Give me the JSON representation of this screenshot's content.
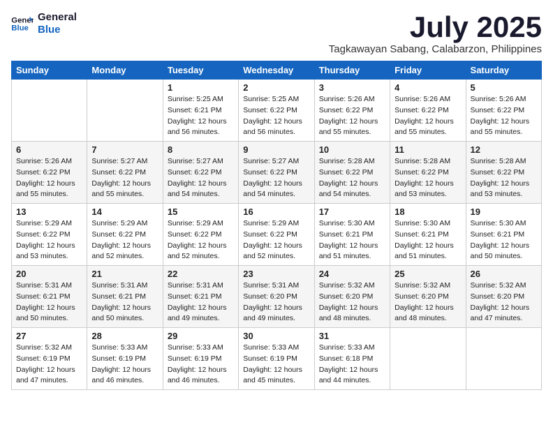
{
  "logo": {
    "line1": "General",
    "line2": "Blue"
  },
  "title": "July 2025",
  "subtitle": "Tagkawayan Sabang, Calabarzon, Philippines",
  "headers": [
    "Sunday",
    "Monday",
    "Tuesday",
    "Wednesday",
    "Thursday",
    "Friday",
    "Saturday"
  ],
  "weeks": [
    [
      {
        "day": "",
        "details": ""
      },
      {
        "day": "",
        "details": ""
      },
      {
        "day": "1",
        "details": "Sunrise: 5:25 AM\nSunset: 6:21 PM\nDaylight: 12 hours\nand 56 minutes."
      },
      {
        "day": "2",
        "details": "Sunrise: 5:25 AM\nSunset: 6:22 PM\nDaylight: 12 hours\nand 56 minutes."
      },
      {
        "day": "3",
        "details": "Sunrise: 5:26 AM\nSunset: 6:22 PM\nDaylight: 12 hours\nand 55 minutes."
      },
      {
        "day": "4",
        "details": "Sunrise: 5:26 AM\nSunset: 6:22 PM\nDaylight: 12 hours\nand 55 minutes."
      },
      {
        "day": "5",
        "details": "Sunrise: 5:26 AM\nSunset: 6:22 PM\nDaylight: 12 hours\nand 55 minutes."
      }
    ],
    [
      {
        "day": "6",
        "details": "Sunrise: 5:26 AM\nSunset: 6:22 PM\nDaylight: 12 hours\nand 55 minutes."
      },
      {
        "day": "7",
        "details": "Sunrise: 5:27 AM\nSunset: 6:22 PM\nDaylight: 12 hours\nand 55 minutes."
      },
      {
        "day": "8",
        "details": "Sunrise: 5:27 AM\nSunset: 6:22 PM\nDaylight: 12 hours\nand 54 minutes."
      },
      {
        "day": "9",
        "details": "Sunrise: 5:27 AM\nSunset: 6:22 PM\nDaylight: 12 hours\nand 54 minutes."
      },
      {
        "day": "10",
        "details": "Sunrise: 5:28 AM\nSunset: 6:22 PM\nDaylight: 12 hours\nand 54 minutes."
      },
      {
        "day": "11",
        "details": "Sunrise: 5:28 AM\nSunset: 6:22 PM\nDaylight: 12 hours\nand 53 minutes."
      },
      {
        "day": "12",
        "details": "Sunrise: 5:28 AM\nSunset: 6:22 PM\nDaylight: 12 hours\nand 53 minutes."
      }
    ],
    [
      {
        "day": "13",
        "details": "Sunrise: 5:29 AM\nSunset: 6:22 PM\nDaylight: 12 hours\nand 53 minutes."
      },
      {
        "day": "14",
        "details": "Sunrise: 5:29 AM\nSunset: 6:22 PM\nDaylight: 12 hours\nand 52 minutes."
      },
      {
        "day": "15",
        "details": "Sunrise: 5:29 AM\nSunset: 6:22 PM\nDaylight: 12 hours\nand 52 minutes."
      },
      {
        "day": "16",
        "details": "Sunrise: 5:29 AM\nSunset: 6:22 PM\nDaylight: 12 hours\nand 52 minutes."
      },
      {
        "day": "17",
        "details": "Sunrise: 5:30 AM\nSunset: 6:21 PM\nDaylight: 12 hours\nand 51 minutes."
      },
      {
        "day": "18",
        "details": "Sunrise: 5:30 AM\nSunset: 6:21 PM\nDaylight: 12 hours\nand 51 minutes."
      },
      {
        "day": "19",
        "details": "Sunrise: 5:30 AM\nSunset: 6:21 PM\nDaylight: 12 hours\nand 50 minutes."
      }
    ],
    [
      {
        "day": "20",
        "details": "Sunrise: 5:31 AM\nSunset: 6:21 PM\nDaylight: 12 hours\nand 50 minutes."
      },
      {
        "day": "21",
        "details": "Sunrise: 5:31 AM\nSunset: 6:21 PM\nDaylight: 12 hours\nand 50 minutes."
      },
      {
        "day": "22",
        "details": "Sunrise: 5:31 AM\nSunset: 6:21 PM\nDaylight: 12 hours\nand 49 minutes."
      },
      {
        "day": "23",
        "details": "Sunrise: 5:31 AM\nSunset: 6:20 PM\nDaylight: 12 hours\nand 49 minutes."
      },
      {
        "day": "24",
        "details": "Sunrise: 5:32 AM\nSunset: 6:20 PM\nDaylight: 12 hours\nand 48 minutes."
      },
      {
        "day": "25",
        "details": "Sunrise: 5:32 AM\nSunset: 6:20 PM\nDaylight: 12 hours\nand 48 minutes."
      },
      {
        "day": "26",
        "details": "Sunrise: 5:32 AM\nSunset: 6:20 PM\nDaylight: 12 hours\nand 47 minutes."
      }
    ],
    [
      {
        "day": "27",
        "details": "Sunrise: 5:32 AM\nSunset: 6:19 PM\nDaylight: 12 hours\nand 47 minutes."
      },
      {
        "day": "28",
        "details": "Sunrise: 5:33 AM\nSunset: 6:19 PM\nDaylight: 12 hours\nand 46 minutes."
      },
      {
        "day": "29",
        "details": "Sunrise: 5:33 AM\nSunset: 6:19 PM\nDaylight: 12 hours\nand 46 minutes."
      },
      {
        "day": "30",
        "details": "Sunrise: 5:33 AM\nSunset: 6:19 PM\nDaylight: 12 hours\nand 45 minutes."
      },
      {
        "day": "31",
        "details": "Sunrise: 5:33 AM\nSunset: 6:18 PM\nDaylight: 12 hours\nand 44 minutes."
      },
      {
        "day": "",
        "details": ""
      },
      {
        "day": "",
        "details": ""
      }
    ]
  ]
}
